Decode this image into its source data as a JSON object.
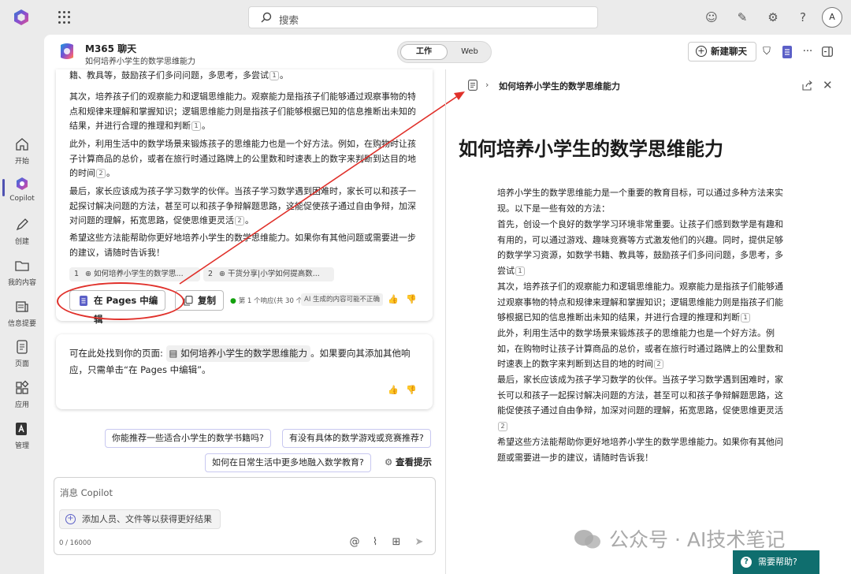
{
  "topbar": {
    "search_placeholder": "搜索",
    "avatar_initial": "A"
  },
  "rail": [
    {
      "label": "开始"
    },
    {
      "label": "Copilot"
    },
    {
      "label": "创建"
    },
    {
      "label": "我的内容"
    },
    {
      "label": "信息提要"
    },
    {
      "label": "页面"
    },
    {
      "label": "应用"
    },
    {
      "label": "管理"
    }
  ],
  "header": {
    "title": "M365 聊天",
    "subtitle": "如何培养小学生的数学思维能力",
    "toggle_work": "工作",
    "toggle_web": "Web",
    "new_chat": "新建聊天"
  },
  "chat": {
    "p0": "籍、教具等，鼓励孩子们多问问题，多思考，多尝试",
    "p0_cite": "1",
    "p1": "其次，培养孩子们的观察能力和逻辑思维能力。观察能力是指孩子们能够通过观察事物的特点和规律来理解和掌握知识；逻辑思维能力则是指孩子们能够根据已知的信息推断出未知的结果，并进行合理的推理和判断",
    "p1_cite": "1",
    "p2": "此外，利用生活中的数学场景来锻炼孩子的思维能力也是一个好方法。例如，在购物时让孩子计算商品的总价，或者在旅行时通过路牌上的公里数和时速表上的数字来判断到达目的地的时间",
    "p2_cite": "2",
    "p3": "最后，家长应该成为孩子学习数学的伙伴。当孩子学习数学遇到困难时，家长可以和孩子一起探讨解决问题的方法，甚至可以和孩子争辩解题思路，这能促使孩子通过自由争辩，加深对问题的理解，拓宽思路，促使思维更灵活",
    "p3_cite": "2",
    "p4": "希望这些方法能帮助你更好地培养小学生的数学思维能力。如果你有其他问题或需要进一步的建议，请随时告诉我！",
    "ref1_num": "1",
    "ref1_text": "如何培养小学生的数学思...",
    "ref2_num": "2",
    "ref2_text": "干货分享|小学如何提高数...",
    "edit_in_pages": "在 Pages 中编辑",
    "copy": "复制",
    "response_count": "第 1 个响应(共 30 个)",
    "ai_badge": "AI",
    "ai_warning": "生成的内容可能不正确"
  },
  "card2": {
    "prefix": "可在此处找到你的页面:",
    "page_name": "如何培养小学生的数学思维能力",
    "suffix": "。如果要向其添加其他响应，只需单击“在 Pages 中编辑”。"
  },
  "suggestions": [
    "你能推荐一些适合小学生的数学书籍吗?",
    "有没有具体的数学游戏或竞赛推荐?",
    "如何在日常生活中更多地融入数学教育?"
  ],
  "view_prompts": "查看提示",
  "input": {
    "placeholder": "消息 Copilot",
    "add_people": "添加人员、文件等以获得更好结果",
    "char_count": "0 / 16000"
  },
  "page": {
    "breadcrumb": "如何培养小学生的数学思维能力",
    "title": "如何培养小学生的数学思维能力",
    "r0": "培养小学生的数学思维能力是一个重要的教育目标，可以通过多种方法来实现。以下是一些有效的方法：",
    "r1": "首先，创设一个良好的数学学习环境非常重要。让孩子们感到数学是有趣和有用的，可以通过游戏、趣味竞赛等方式激发他们的兴趣。同时，提供足够的数学学习资源，如数学书籍、教具等，鼓励孩子们多问问题，多思考，多尝试",
    "r1_cite": "1",
    "r2": "其次，培养孩子们的观察能力和逻辑思维能力。观察能力是指孩子们能够通过观察事物的特点和规律来理解和掌握知识；逻辑思维能力则是指孩子们能够根据已知的信息推断出未知的结果，并进行合理的推理和判断",
    "r2_cite": "1",
    "r3": "此外，利用生活中的数学场景来锻炼孩子的思维能力也是一个好方法。例如，在购物时让孩子计算商品的总价，或者在旅行时通过路牌上的公里数和时速表上的数字来判断到达目的地的时间",
    "r3_cite": "2",
    "r4": "最后，家长应该成为孩子学习数学的伙伴。当孩子学习数学遇到困难时，家长可以和孩子一起探讨解决问题的方法，甚至可以和孩子争辩解题思路，这能促使孩子通过自由争辩，加深对问题的理解，拓宽思路，促使思维更灵活",
    "r4_cite": "2",
    "r5": "希望这些方法能帮助你更好地培养小学生的数学思维能力。如果你有其他问题或需要进一步的建议，请随时告诉我！"
  },
  "watermark": "公众号 · AI技术笔记",
  "help": "需要帮助?",
  "colors": {
    "accent": "#5b5fc7",
    "annotation_red": "#e0302a",
    "help_bg": "#0f6e6e"
  }
}
